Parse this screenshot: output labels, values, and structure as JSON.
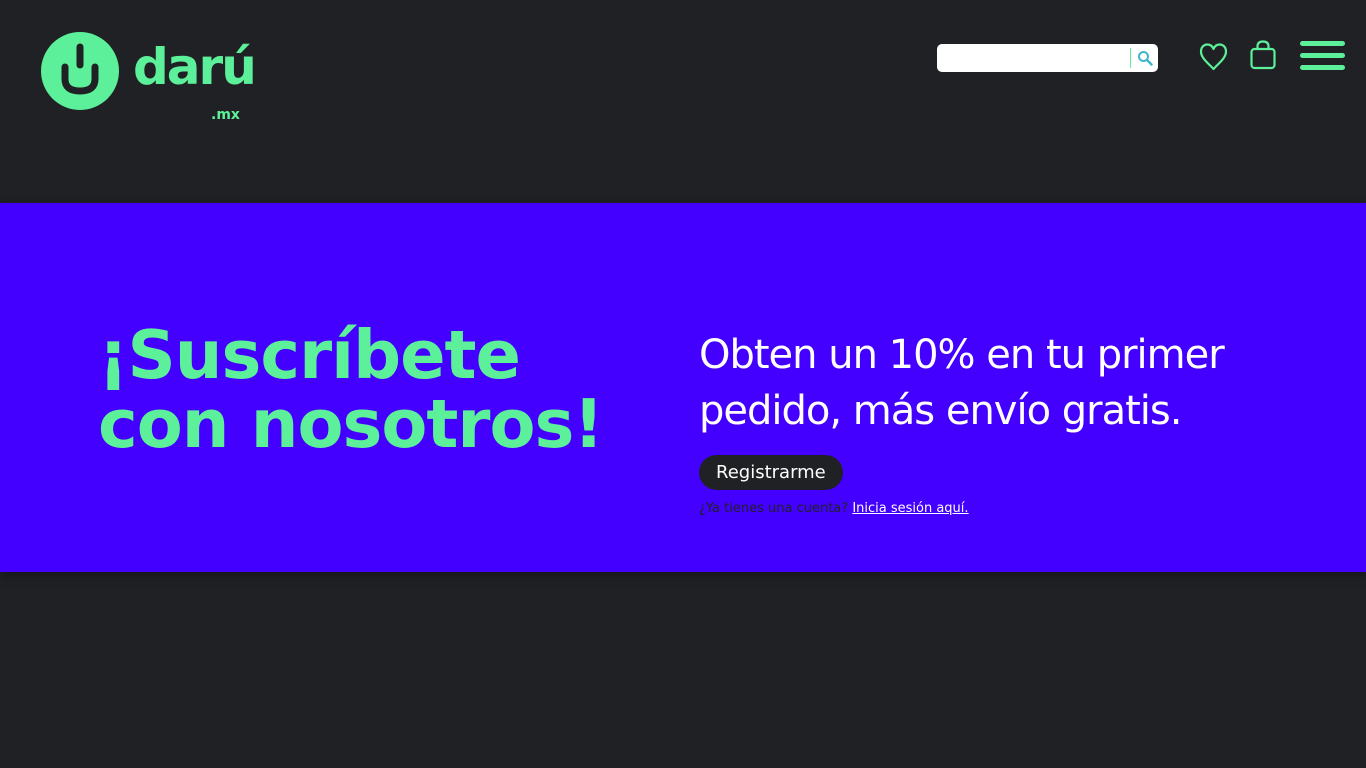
{
  "header": {
    "logo": {
      "word": "darú",
      "tld": ".mx"
    },
    "search": {
      "value": "",
      "placeholder": ""
    },
    "icons": [
      "search-icon",
      "heart-icon",
      "shopping-bag-icon",
      "hamburger-menu-icon"
    ]
  },
  "banner": {
    "headline": [
      "¡Suscríbete",
      "con nosotros!"
    ],
    "offer": [
      "Obten un 10% en tu primer",
      "pedido, más envío gratis."
    ],
    "register_label": "Registrarme",
    "login_question": "¿Ya tienes una cuenta?",
    "login_link": "Inicia sesión aquí."
  },
  "colors": {
    "background": "#202124",
    "accent": "#5cf09a",
    "banner": "#4400ff",
    "white": "#ffffff"
  }
}
